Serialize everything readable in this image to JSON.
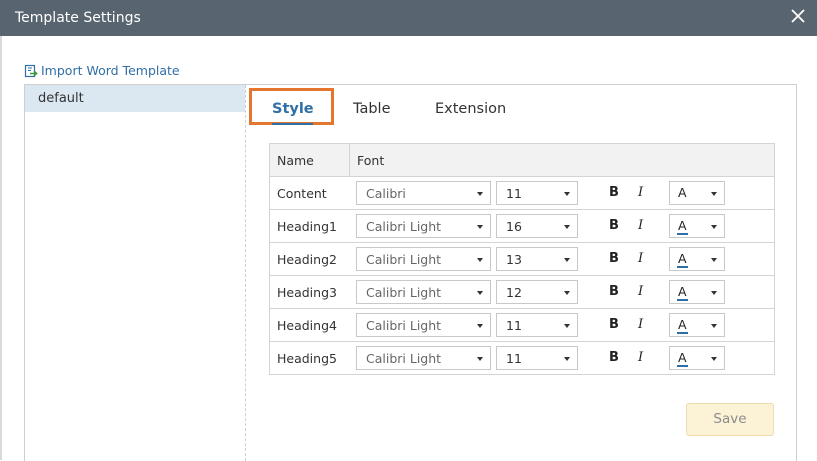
{
  "window": {
    "title": "Template Settings",
    "close_icon": "close-icon"
  },
  "import_link": {
    "label": "Import Word Template",
    "icon": "import-icon"
  },
  "templates": [
    {
      "label": "default",
      "selected": true
    }
  ],
  "tabs": [
    {
      "label": "Style",
      "active": true
    },
    {
      "label": "Table",
      "active": false
    },
    {
      "label": "Extension",
      "active": false
    }
  ],
  "grid": {
    "headers": {
      "name": "Name",
      "font": "Font"
    },
    "rows": [
      {
        "name": "Content",
        "font": "Calibri",
        "size": "11",
        "bold": "B",
        "italic": "I",
        "color": "A"
      },
      {
        "name": "Heading1",
        "font": "Calibri Light",
        "size": "16",
        "bold": "B",
        "italic": "I",
        "color": "A"
      },
      {
        "name": "Heading2",
        "font": "Calibri Light",
        "size": "13",
        "bold": "B",
        "italic": "I",
        "color": "A"
      },
      {
        "name": "Heading3",
        "font": "Calibri Light",
        "size": "12",
        "bold": "B",
        "italic": "I",
        "color": "A"
      },
      {
        "name": "Heading4",
        "font": "Calibri Light",
        "size": "11",
        "bold": "B",
        "italic": "I",
        "color": "A"
      },
      {
        "name": "Heading5",
        "font": "Calibri Light",
        "size": "11",
        "bold": "B",
        "italic": "I",
        "color": "A"
      }
    ]
  },
  "actions": {
    "save_label": "Save"
  },
  "colors": {
    "titlebar": "#586570",
    "accent": "#2f6fa6",
    "highlight": "#e4772d",
    "selected_item": "#dce8f1",
    "save_button_bg": "#fcf2d6"
  }
}
